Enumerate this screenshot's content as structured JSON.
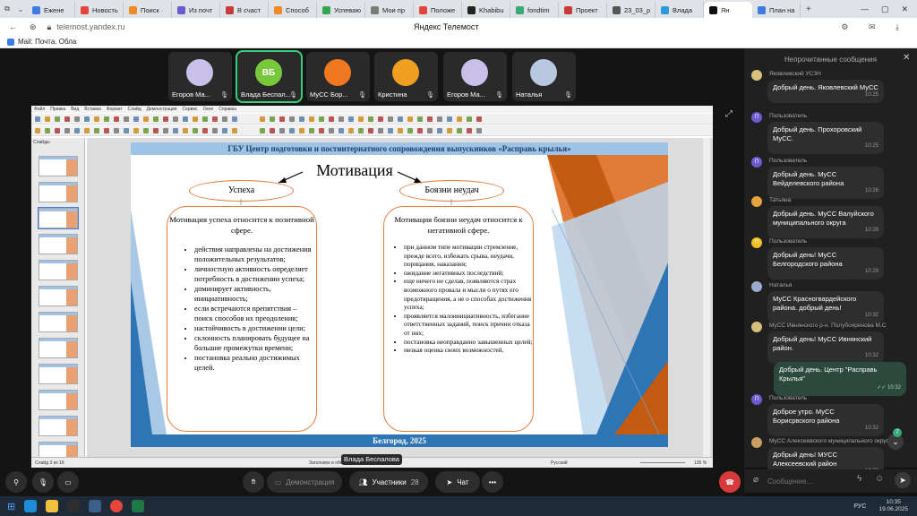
{
  "browser": {
    "tabs": [
      {
        "label": "Ежене"
      },
      {
        "label": "Новость"
      },
      {
        "label": "Поиск ·"
      },
      {
        "label": "Из почт"
      },
      {
        "label": "В счаст"
      },
      {
        "label": "Способ"
      },
      {
        "label": "Успеваю"
      },
      {
        "label": "Мои пр"
      },
      {
        "label": "Положе"
      },
      {
        "label": "Khabibu"
      },
      {
        "label": "fondtim"
      },
      {
        "label": "Проект"
      },
      {
        "label": "23_03_p"
      },
      {
        "label": "Влада"
      },
      {
        "label": "Ян"
      },
      {
        "label": "План на"
      }
    ],
    "url": "telemost.yandex.ru",
    "page_title": "Яндекс Телемост",
    "bookmark": "Mail: Почта. Обла"
  },
  "participants": [
    {
      "name": "Егоров Ма...",
      "initials": "",
      "color": "#c8c0e8"
    },
    {
      "name": "Влада Беспал...",
      "initials": "ВБ",
      "color": "#78c83c"
    },
    {
      "name": "МуСС Бор...",
      "initials": "",
      "color": "#f07820"
    },
    {
      "name": "Кристина",
      "initials": "",
      "color": "#f0a020"
    },
    {
      "name": "Егоров Ма...",
      "initials": "",
      "color": "#c8c0e8"
    },
    {
      "name": "Наталья",
      "initials": "",
      "color": "#b8c8e0"
    }
  ],
  "speaker_tag": "Влада Беспалова",
  "lo": {
    "menu": [
      "Файл",
      "Правка",
      "Вид",
      "Вставка",
      "Формат",
      "Слайд",
      "Демонстрация",
      "Сервис",
      "Окно",
      "Справка"
    ],
    "slides_label": "Слайды",
    "status_left": "Слайд 3 из 16",
    "status_mid": "Заголовок и объ",
    "status_lang": "Русский",
    "status_zoom": "135 %"
  },
  "slide": {
    "header": "ГБУ Центр подготовки и постинтернатного сопровождения выпускников «Расправь крылья»",
    "title": "Мотивация",
    "left_oval": "Успеха",
    "right_oval": "Боязни неудач",
    "left_heading": "Мотивация успеха относится к позитивной сфере.",
    "left_items": [
      "действия направлены на достижения положительных результатов;",
      "личностную активность определяет потребность в достижении успеха;",
      "доминирует активность, инициативность;",
      "если встречаются препятствия – поиск способов их преодоления;",
      "настойчивость в достижении цели;",
      "склонность планировать будущее на большие промежутки времени;",
      "постановка реально достижимых целей."
    ],
    "right_heading": "Мотивация боязни неудач относится к негативной сфере.",
    "right_items": [
      "при данном типе мотивации стремление, прежде всего, избежать срыва, неудачи, порицания, наказания;",
      "ожидание негативных последствий;",
      "еще ничего не сделав, появляются страх возможного провала и мысли о путях его предотвращения, а не о способах достижения успеха;",
      "проявляется малоинициативность, избегание ответственных заданий, поиск причин отказа от них;",
      "постановка неоправданно завышенных целей;",
      "низкая оценка своих возможностей."
    ],
    "footer": "Белгород, 2025"
  },
  "chat": {
    "header": "Непрочитанные сообщения",
    "messages": [
      {
        "author": "Яковлевский УСЗН",
        "icon": "",
        "icon_color": "#d9c07a",
        "text": "Добрый день. Яковлевский МуСС",
        "time": "10:25"
      },
      {
        "author": "Пользователь",
        "icon": "П",
        "icon_color": "#6b5bd1",
        "text": "Добрый день. Прохоровский МуСС.",
        "time": "10:25"
      },
      {
        "author": "Пользователь",
        "icon": "П",
        "icon_color": "#6b5bd1",
        "text": "Добрый день. МуСС Вейделевского района",
        "time": "10:26"
      },
      {
        "author": "Татьяна",
        "icon": "",
        "icon_color": "#e6a23c",
        "text": "Добрый день. МуСС Валуйского муниципального округа",
        "time": "10:26"
      },
      {
        "author": "Пользователь",
        "icon": "П",
        "icon_color": "#f0c020",
        "text": "Добрый день! МуСС Белгородского района",
        "time": "10:29"
      },
      {
        "author": "Наталья",
        "icon": "",
        "icon_color": "#9aaccc",
        "text": "МуСС Красногвардейского района. добрый день!",
        "time": "10:32"
      },
      {
        "author": "МуСС Ивнянского р-н. Полубояринова М.С",
        "icon": "",
        "icon_color": "#d9c07a",
        "text": "Добрый день! МуСС Ивнянский район.",
        "time": "10:32"
      },
      {
        "author": "Пользователь",
        "icon": "П",
        "icon_color": "#6b5bd1",
        "text": "Доброе утро. МуСС Борисрвского района",
        "time": "10:32"
      },
      {
        "author": "МуСС Алексеевского муниципального округа",
        "icon": "",
        "icon_color": "#c9a060",
        "text": "Добрый день! МУСС Алексеевский район",
        "time": "10:32"
      }
    ],
    "own_message": {
      "text": "Добрый день. Центр \"Расправь Крылья\"",
      "time": "10:32"
    },
    "unread_badge": "7",
    "input_placeholder": "Сообщение..."
  },
  "controls": {
    "demo_label": "Демонстрация",
    "participants_label": "Участники",
    "participants_count": "28",
    "chat_label": "Чат"
  },
  "taskbar": {
    "lang": "РУС",
    "time": "10:35",
    "date": "19.06.2025"
  }
}
